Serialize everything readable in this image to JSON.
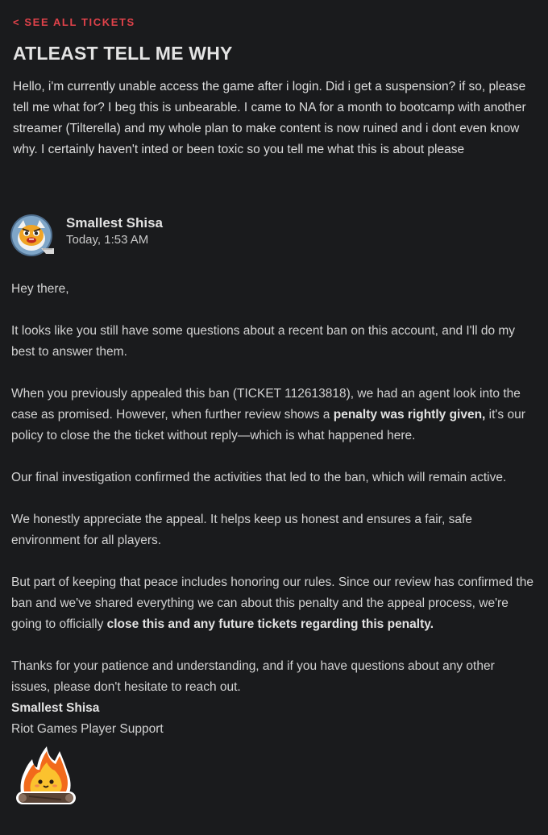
{
  "nav": {
    "back_label": "< SEE ALL TICKETS"
  },
  "ticket": {
    "title": "ATLEAST TELL ME WHY",
    "body": "Hello, i'm currently unable access the game after i login. Did i get a suspension? if so, please tell me what for? I beg this is unbearable. I came to NA for a month to bootcamp with another streamer (Tilterella) and my whole plan to make content is now ruined and i dont even know why. I certainly haven't inted or been toxic so you tell me what this is about please"
  },
  "reply": {
    "author": "Smallest Shisa",
    "timestamp": "Today, 1:53 AM",
    "avatar_icon": "angry-poro-avatar-icon",
    "greeting": "Hey there,",
    "p1": "It looks like you still have some questions about a recent ban on this account, and I'll do my best to answer them.",
    "p2_a": "When you previously appealed this ban (TICKET 112613818), we had an agent look into the case as promised. However, when further review shows a ",
    "p2_bold": "penalty was rightly given,",
    "p2_b": " it's our policy to close the the ticket without reply—which is what happened here.",
    "p3": "Our final investigation confirmed the activities that led to the ban, which will remain active.",
    "p4": "We honestly appreciate the appeal. It helps keep us honest and ensures a fair, safe environment for all players.",
    "p5_a": "But part of keeping that peace includes honoring our rules. Since our review has confirmed the ban and we've shared everything we can about this penalty and the appeal process, we're going to officially ",
    "p5_bold": "close this and any future tickets regarding this penalty.",
    "p6": "Thanks for your patience and understanding, and if you have questions about any other issues, please don't hesitate to reach out.",
    "signature_name": "Smallest Shisa",
    "signature_team": "Riot Games Player Support",
    "sticker_icon": "campfire-sticker-icon"
  },
  "colors": {
    "background": "#1a1b1d",
    "accent": "#e0424a",
    "text": "#d8d8d8"
  }
}
